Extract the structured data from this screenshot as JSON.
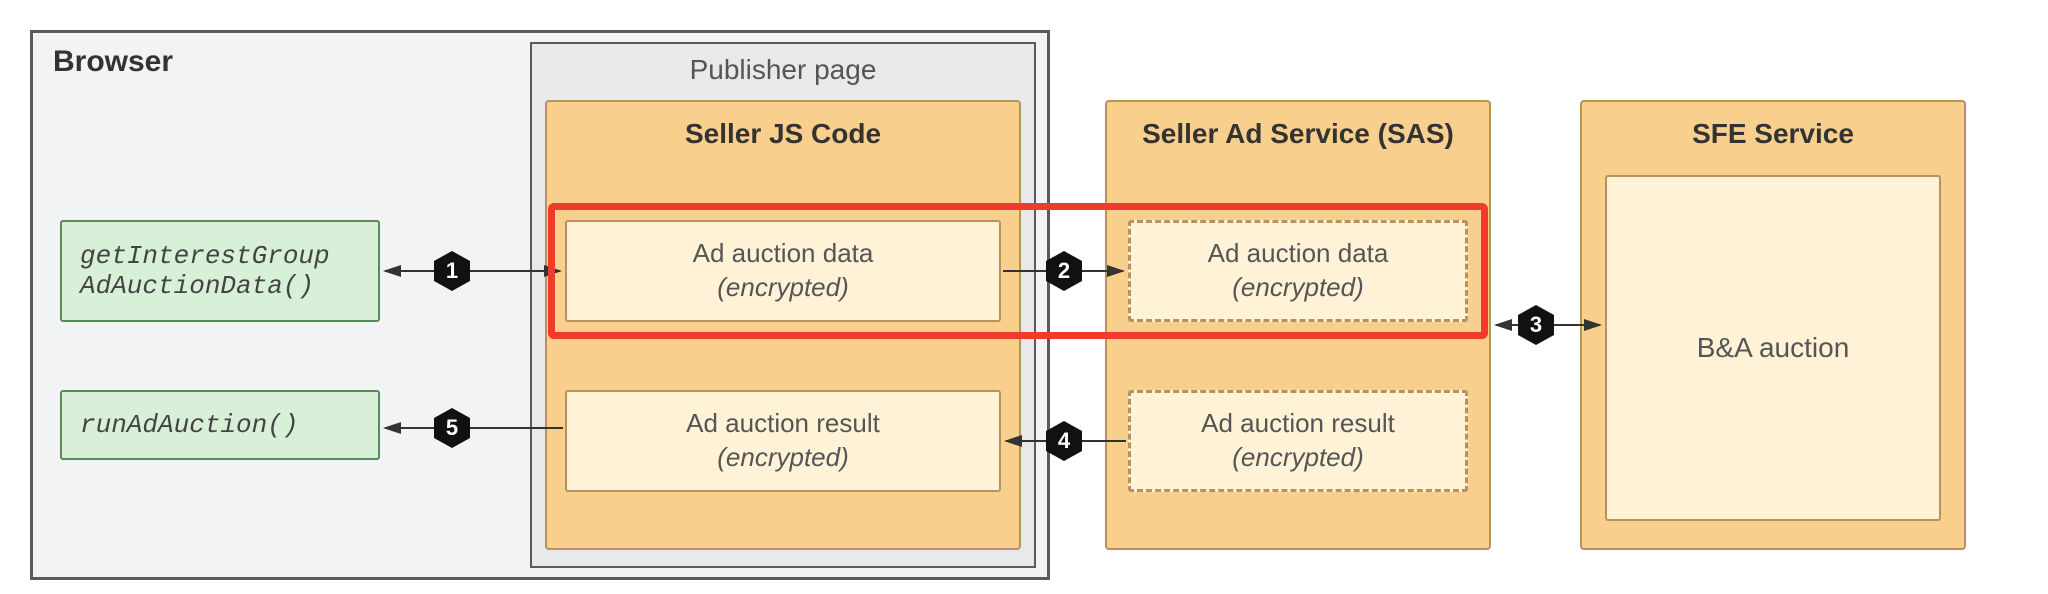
{
  "browser_label": "Browser",
  "publisher_label": "Publisher page",
  "seller_js_title": "Seller JS Code",
  "seller_sas_title": "Seller Ad Service (SAS)",
  "sfe_title": "SFE Service",
  "api": {
    "getInterestGroup_line1": "getInterestGroup",
    "getInterestGroup_line2": "AdAuctionData()",
    "runAdAuction": "runAdAuction()"
  },
  "boxes": {
    "ad_data_label": "Ad auction data",
    "ad_result_label": "Ad auction result",
    "encrypted_sub": "(encrypted)",
    "ba_auction": "B&A auction"
  },
  "steps": {
    "s1": "1",
    "s2": "2",
    "s3": "3",
    "s4": "4",
    "s5": "5"
  }
}
